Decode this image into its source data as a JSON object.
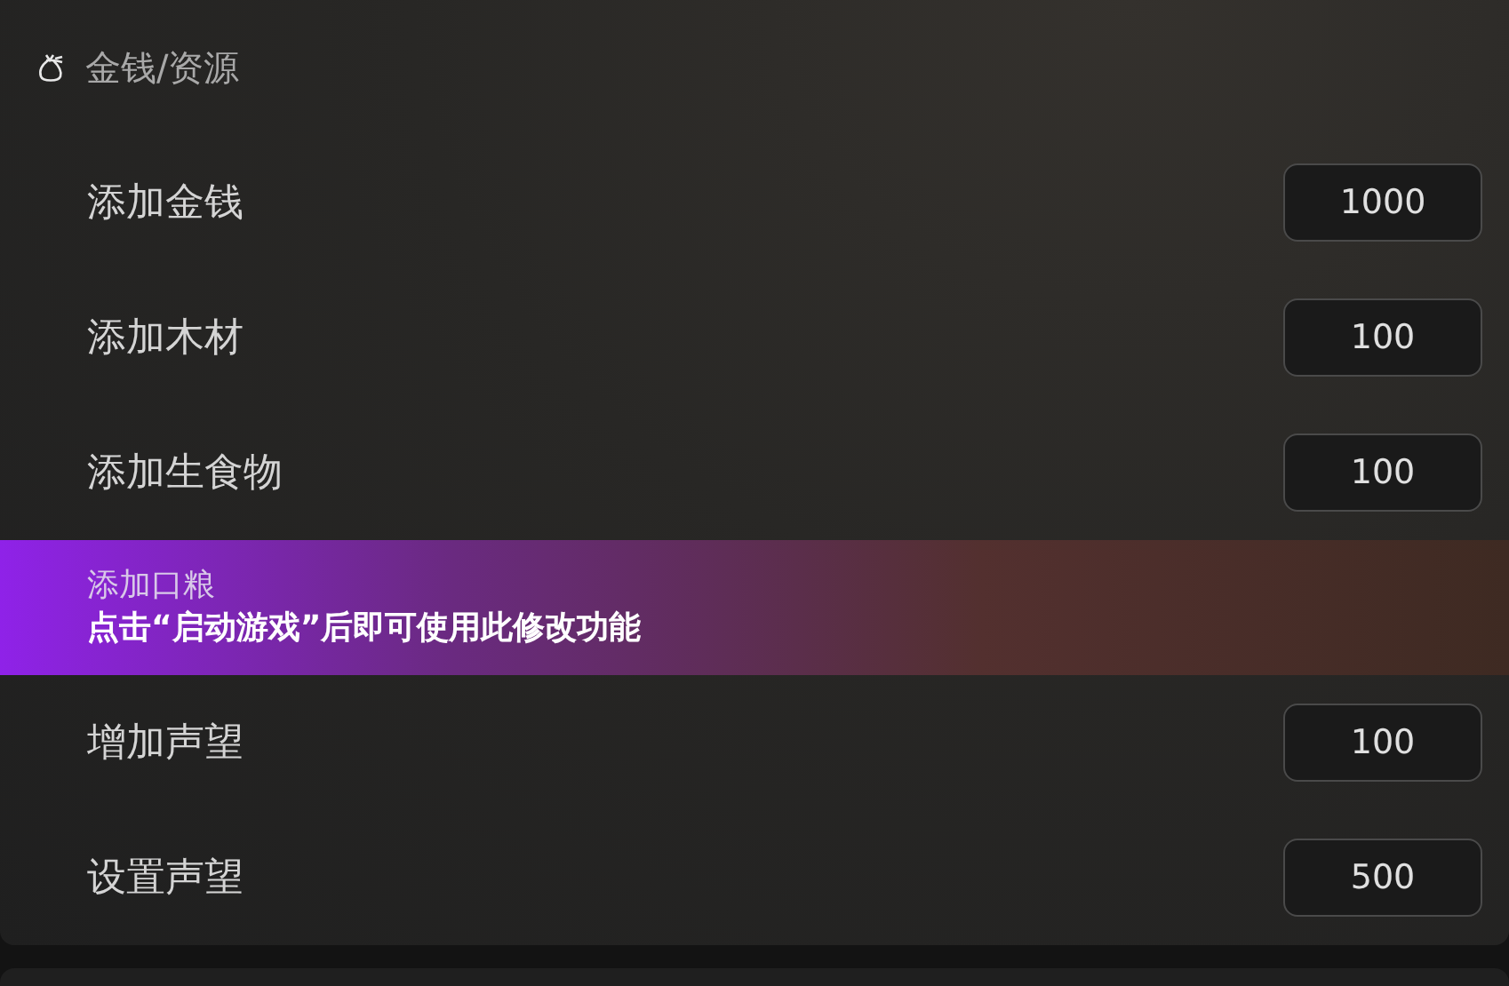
{
  "section": {
    "title": "金钱/资源"
  },
  "rows": [
    {
      "kind": "input",
      "label": "添加金钱",
      "value": "1000"
    },
    {
      "kind": "input",
      "label": "添加木材",
      "value": "100"
    },
    {
      "kind": "input",
      "label": "添加生食物",
      "value": "100"
    },
    {
      "kind": "locked",
      "label": "添加口粮",
      "notice": "点击“启动游戏”后即可使用此修改功能"
    },
    {
      "kind": "input",
      "label": "增加声望",
      "value": "100"
    },
    {
      "kind": "input",
      "label": "设置声望",
      "value": "500"
    }
  ]
}
